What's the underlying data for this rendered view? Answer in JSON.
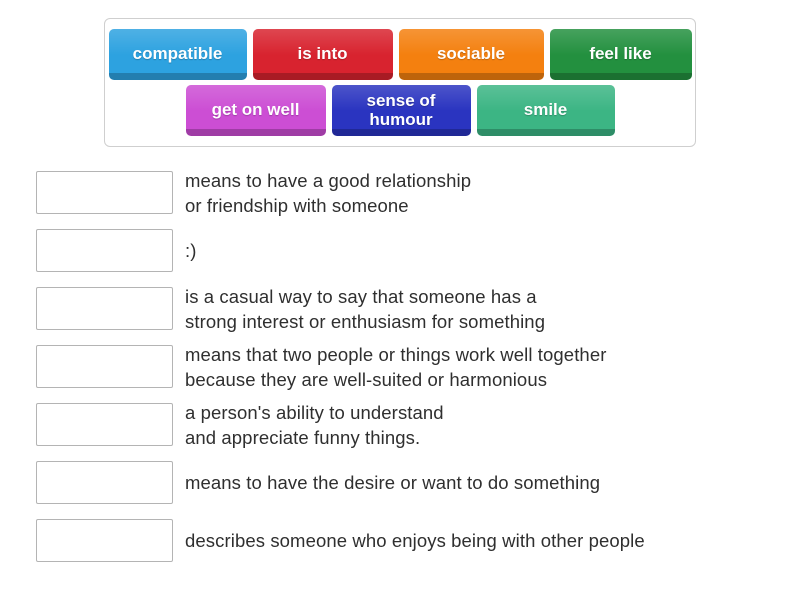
{
  "word_bank": {
    "rows": [
      [
        {
          "label": "compatible",
          "color": "#2da2e0",
          "size_class": "tile-w-compatible",
          "name": "tile-compatible"
        },
        {
          "label": "is into",
          "color": "#d8232f",
          "size_class": "tile-w-isinto",
          "name": "tile-is-into"
        },
        {
          "label": "sociable",
          "color": "#f4800f",
          "size_class": "tile-w-sociable",
          "name": "tile-sociable"
        },
        {
          "label": "feel like",
          "color": "#23903f",
          "size_class": "tile-w-feellike",
          "name": "tile-feel-like"
        }
      ],
      [
        {
          "label": "get on well",
          "color": "#cc4ed4",
          "size_class": "tile-w-getonwell",
          "name": "tile-get-on-well"
        },
        {
          "label": "sense of\nhumour",
          "color": "#2a34c0",
          "size_class": "tile-w-senseof",
          "name": "tile-sense-of-humour"
        },
        {
          "label": "smile",
          "color": "#3cb584",
          "size_class": "tile-w-smile",
          "name": "tile-smile"
        }
      ]
    ]
  },
  "answers": [
    {
      "definition": "means to have a good relationship\nor friendship with someone",
      "value": ""
    },
    {
      "definition": ":)",
      "value": ""
    },
    {
      "definition": "is a casual way to say that someone has a\nstrong interest or enthusiasm for something",
      "value": ""
    },
    {
      "definition": "means that two people or things work well together\nbecause they are well-suited or harmonious",
      "value": ""
    },
    {
      "definition": "a person's ability to understand\nand appreciate funny things.",
      "value": ""
    },
    {
      "definition": "means to have the desire or want to do something",
      "value": ""
    },
    {
      "definition": "describes someone who enjoys being with other people",
      "value": ""
    }
  ]
}
